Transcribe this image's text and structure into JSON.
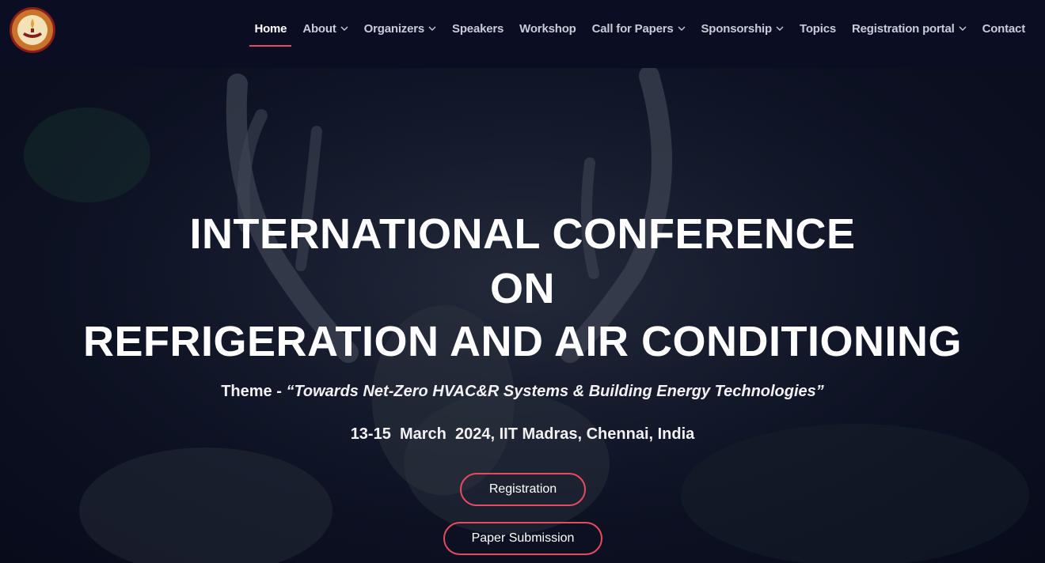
{
  "brand": {
    "logo_text": "INDIAN INSTITUTE OF TECHNOLOGY MADRAS"
  },
  "nav": {
    "items": [
      {
        "label": "Home",
        "active": true,
        "dropdown": false
      },
      {
        "label": "About",
        "active": false,
        "dropdown": true
      },
      {
        "label": "Organizers",
        "active": false,
        "dropdown": true
      },
      {
        "label": "Speakers",
        "active": false,
        "dropdown": false
      },
      {
        "label": "Workshop",
        "active": false,
        "dropdown": false
      },
      {
        "label": "Call for Papers",
        "active": false,
        "dropdown": true
      },
      {
        "label": "Sponsorship",
        "active": false,
        "dropdown": true
      },
      {
        "label": "Topics",
        "active": false,
        "dropdown": false
      },
      {
        "label": "Registration portal",
        "active": false,
        "dropdown": true
      },
      {
        "label": "Contact",
        "active": false,
        "dropdown": false
      }
    ]
  },
  "hero": {
    "title_line1": "INTERNATIONAL CONFERENCE",
    "title_line2": "ON",
    "title_line3": "REFRIGERATION AND AIR CONDITIONING",
    "theme_prefix": "Theme - ",
    "theme_text": "“Towards Net-Zero HVAC&R Systems & Building Energy Technologies”",
    "dates": "13-15  March  2024, IIT Madras, Chennai, India",
    "registration_button": "Registration",
    "paper_button": "Paper Submission"
  },
  "colors": {
    "accent": "#e84a5f",
    "header_bg": "#0b0d22",
    "hero_bg": "#0d1224"
  }
}
